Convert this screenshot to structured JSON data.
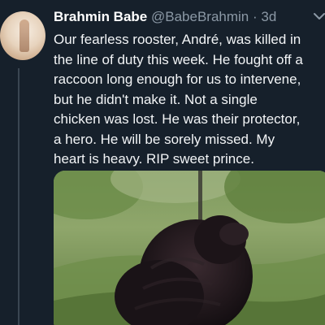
{
  "tweet": {
    "display_name": "Brahmin Babe",
    "handle": "@BabeBrahmin",
    "separator": "·",
    "time": "3d",
    "text_lines": [
      "Our fearless rooster, André, was killed in",
      "the line of duty this week. He fought off a",
      "raccoon long enough for us to intervene,",
      "but he didn't make it. Not a single",
      "chicken was lost. He was their protector,",
      "a hero. He will be sorely missed. My",
      "heart is heavy. RIP sweet prince."
    ]
  },
  "icons": {
    "caret": "chevron-down-icon"
  },
  "colors": {
    "background": "#16202b",
    "secondary_text": "#8b98a5",
    "primary_text": "#ffffff",
    "thread_line": "#3a4652"
  }
}
